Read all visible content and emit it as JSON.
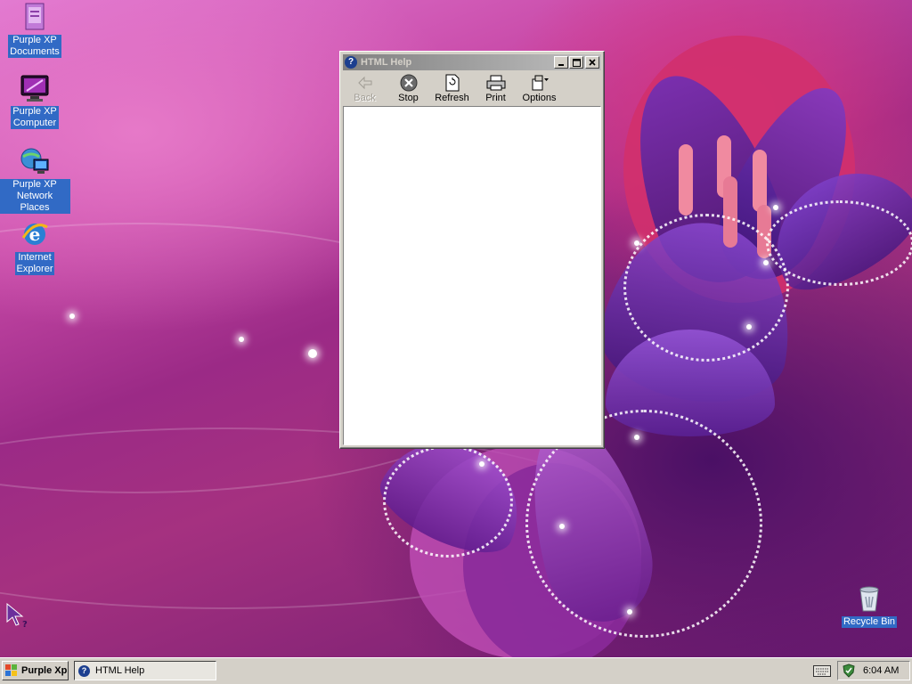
{
  "desktop": {
    "icons": [
      {
        "label_line1": "Purple XP",
        "label_line2": "Documents",
        "icon": "documents-icon"
      },
      {
        "label_line1": "Purple XP",
        "label_line2": "Computer",
        "icon": "computer-icon"
      },
      {
        "label_line1": "Purple XP",
        "label_line2": "Network Places",
        "icon": "network-places-icon"
      },
      {
        "label_line1": "Internet",
        "label_line2": "Explorer",
        "icon": "internet-explorer-icon"
      }
    ],
    "recycle_bin": {
      "label": "Recycle Bin",
      "icon": "recycle-bin-icon"
    }
  },
  "window": {
    "title": "HTML Help",
    "controls": {
      "minimize": "minimize-icon",
      "maximize": "maximize-icon",
      "close": "close-icon"
    },
    "toolbar": [
      {
        "label": "Back",
        "icon": "back-arrow-icon",
        "enabled": false
      },
      {
        "label": "Stop",
        "icon": "stop-icon",
        "enabled": true
      },
      {
        "label": "Refresh",
        "icon": "refresh-icon",
        "enabled": true
      },
      {
        "label": "Print",
        "icon": "printer-icon",
        "enabled": true
      },
      {
        "label": "Options",
        "icon": "options-icon",
        "enabled": true
      }
    ]
  },
  "taskbar": {
    "start_label": "Purple Xp",
    "tasks": [
      {
        "label": "HTML Help",
        "icon": "help-icon"
      }
    ],
    "clock": "6:04 AM"
  },
  "colors": {
    "taskbar": "#d4d0c8",
    "selection": "#316ac5",
    "title_bar_inactive": "#808080"
  }
}
